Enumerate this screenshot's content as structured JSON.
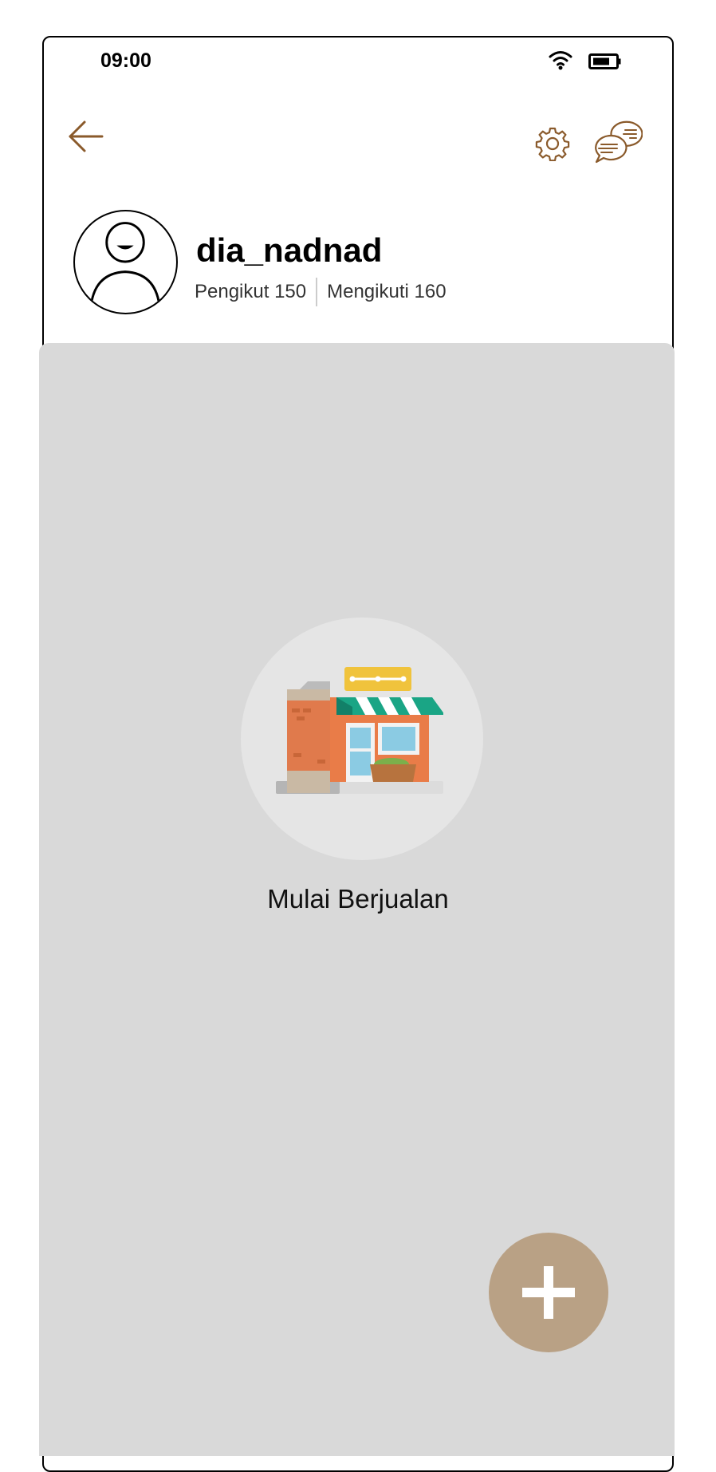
{
  "status_bar": {
    "time": "09:00",
    "icons": [
      "wifi-icon",
      "battery-icon"
    ]
  },
  "header": {
    "icons": [
      "back-arrow-icon",
      "gear-icon",
      "chat-bubbles-icon"
    ]
  },
  "profile": {
    "username": "dia_nadnad",
    "followers_label": "Pengikut 150",
    "following_label": "Mengikuti 160",
    "avatar_icon": "person-avatar-icon"
  },
  "shop": {
    "empty_label": "Mulai Berjualan",
    "illustration": "storefront-illustration",
    "fab_icon": "plus-icon"
  },
  "colors": {
    "accent": "#8a5a2b",
    "panel": "#d9d9d9",
    "circle": "#e5e5e5",
    "fab": "#b9a185"
  }
}
